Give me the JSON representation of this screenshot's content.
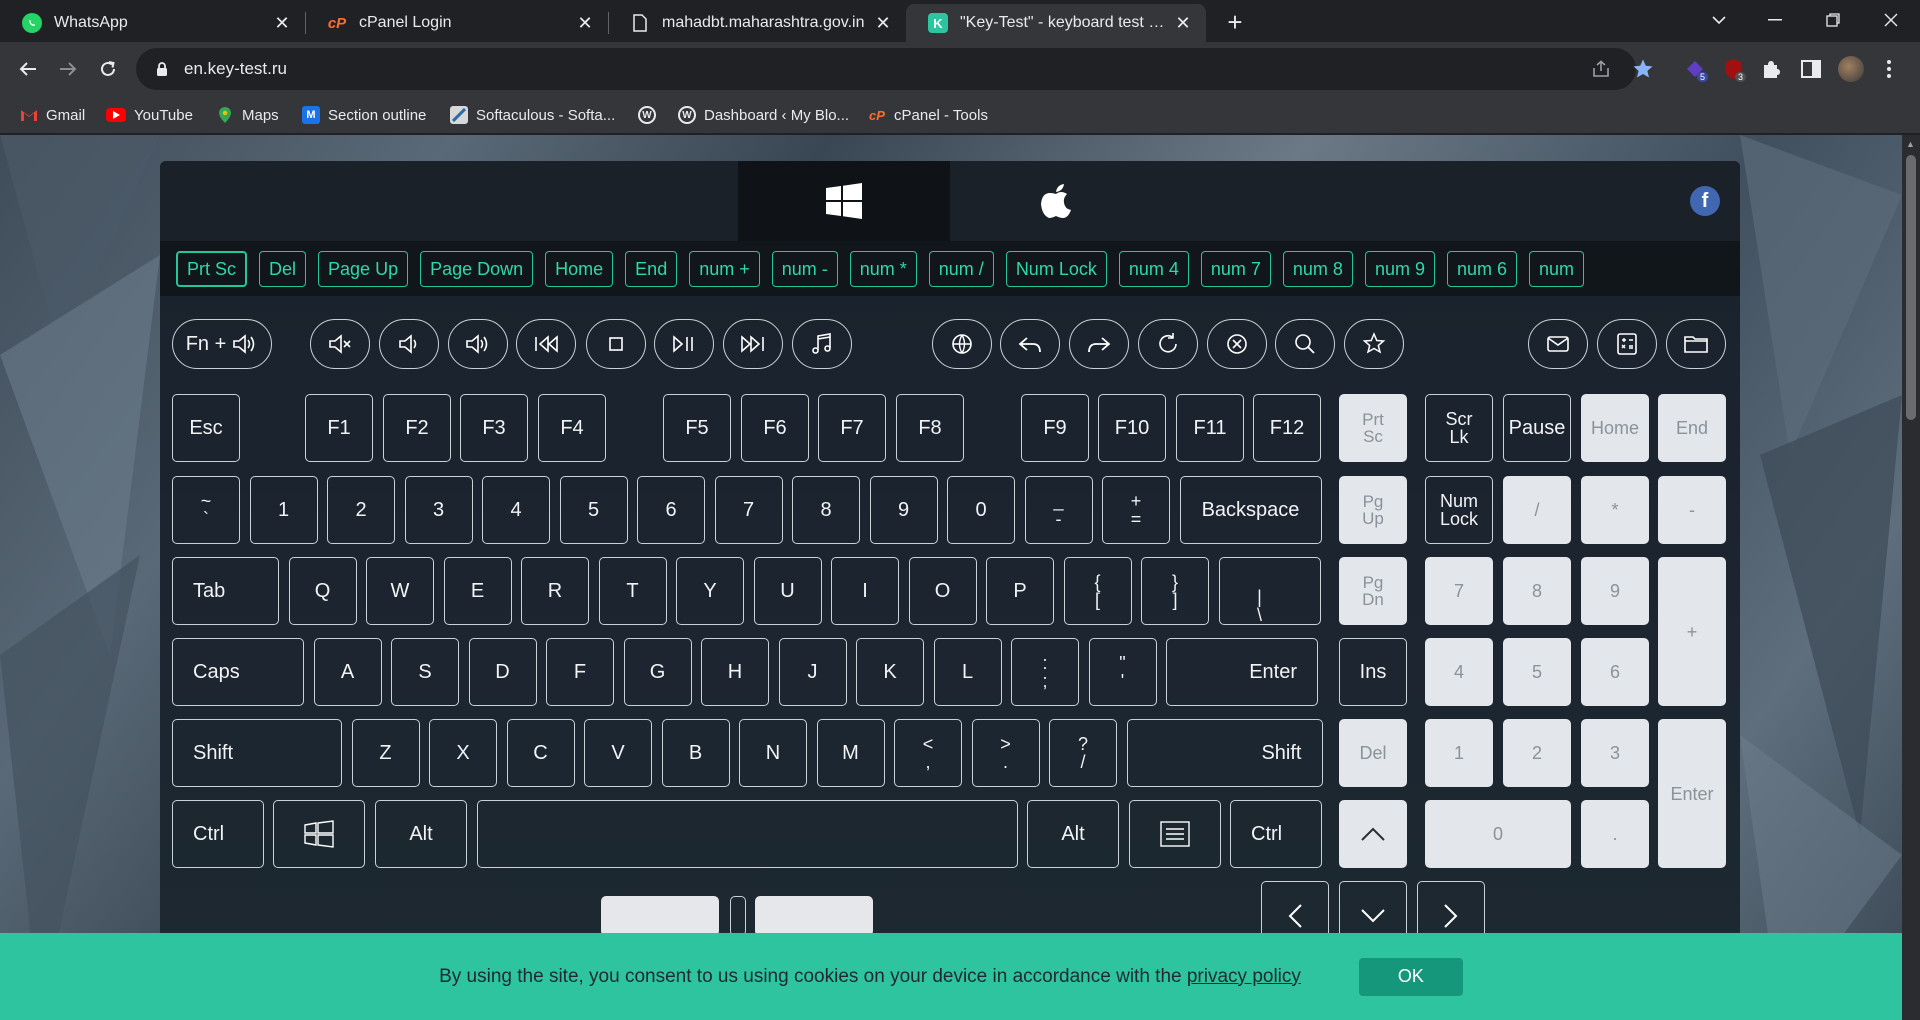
{
  "browser": {
    "tabs": [
      {
        "title": "WhatsApp",
        "icon": "whatsapp-icon",
        "color": "#25d366"
      },
      {
        "title": "cPanel Login",
        "icon": "cpanel-icon",
        "color": "#ff6c2c"
      },
      {
        "title": "mahadbt.maharashtra.gov.in",
        "icon": "page-icon",
        "color": "#ffffff"
      },
      {
        "title": "\"Key-Test\" - keyboard test online",
        "icon": "keytest-icon",
        "color": "#2ec4a0"
      }
    ],
    "new_tab_label": "+",
    "url": "en.key-test.ru",
    "extension_badges": {
      "ext1": "5",
      "ext2": "3"
    },
    "bookmarks": [
      {
        "label": "Gmail",
        "icon": "gmail-icon"
      },
      {
        "label": "YouTube",
        "icon": "youtube-icon"
      },
      {
        "label": "Maps",
        "icon": "maps-icon"
      },
      {
        "label": "Section outline",
        "icon": "moodle-icon"
      },
      {
        "label": "Softaculous - Softa...",
        "icon": "softaculous-icon"
      },
      {
        "label": "",
        "icon": "wordpress-icon"
      },
      {
        "label": "Dashboard ‹ My Blo...",
        "icon": "wordpress-icon"
      },
      {
        "label": "cPanel - Tools",
        "icon": "cpanel-icon"
      }
    ]
  },
  "site": {
    "os_tabs": [
      {
        "name": "windows-logo-icon",
        "active": true
      },
      {
        "name": "apple-logo-icon",
        "active": false
      }
    ],
    "social": "f",
    "history": [
      "Prt Sc",
      "Del",
      "Page Up",
      "Page Down",
      "Home",
      "End",
      "num +",
      "num -",
      "num *",
      "num /",
      "Num Lock",
      "num 4",
      "num 7",
      "num 8",
      "num 9",
      "num 6",
      "num"
    ],
    "fn_key": "Fn +",
    "rows": {
      "row1": [
        "Esc",
        "F1",
        "F2",
        "F3",
        "F4",
        "F5",
        "F6",
        "F7",
        "F8",
        "F9",
        "F10",
        "F11",
        "F12"
      ],
      "row1_extra": [
        [
          "Prt",
          "Sc"
        ],
        [
          "Scr",
          "Lk"
        ],
        [
          "Pause"
        ],
        [
          "Home"
        ],
        [
          "End"
        ]
      ],
      "row2": [
        [
          "~",
          "`"
        ],
        [
          "1"
        ],
        [
          "2"
        ],
        [
          "3"
        ],
        [
          "4"
        ],
        [
          "5"
        ],
        [
          "6"
        ],
        [
          "7"
        ],
        [
          "8"
        ],
        [
          "9"
        ],
        [
          "0"
        ],
        [
          "_",
          "-"
        ],
        [
          "+",
          "="
        ],
        [
          "Backspace"
        ]
      ],
      "row2_extra": [
        [
          "Pg",
          "Up"
        ],
        [
          "Num",
          "Lock"
        ],
        [
          "/"
        ],
        [
          "*"
        ],
        [
          "-"
        ]
      ],
      "row3": [
        [
          "Tab"
        ],
        [
          "Q"
        ],
        [
          "W"
        ],
        [
          "E"
        ],
        [
          "R"
        ],
        [
          "T"
        ],
        [
          "Y"
        ],
        [
          "U"
        ],
        [
          "I"
        ],
        [
          "O"
        ],
        [
          "P"
        ],
        [
          "{",
          "["
        ],
        [
          "}",
          "]"
        ],
        [
          "|",
          "\\"
        ]
      ],
      "row3_extra": [
        [
          "Pg",
          "Dn"
        ],
        [
          "7"
        ],
        [
          "8"
        ],
        [
          "9"
        ],
        [
          "+"
        ]
      ],
      "row4": [
        [
          "Caps"
        ],
        [
          "A"
        ],
        [
          "S"
        ],
        [
          "D"
        ],
        [
          "F"
        ],
        [
          "G"
        ],
        [
          "H"
        ],
        [
          "J"
        ],
        [
          "K"
        ],
        [
          "L"
        ],
        [
          ":",
          ";"
        ],
        [
          "\"",
          "'"
        ],
        [
          "Enter"
        ]
      ],
      "row4_extra": [
        [
          "Ins"
        ],
        [
          "4"
        ],
        [
          "5"
        ],
        [
          "6"
        ]
      ],
      "row5": [
        [
          "Shift"
        ],
        [
          "Z"
        ],
        [
          "X"
        ],
        [
          "C"
        ],
        [
          "V"
        ],
        [
          "B"
        ],
        [
          "N"
        ],
        [
          "M"
        ],
        [
          "<",
          ","
        ],
        [
          ">",
          "."
        ],
        [
          "?",
          "/"
        ],
        [
          "Shift"
        ]
      ],
      "row5_extra": [
        [
          "Del"
        ],
        [
          "1"
        ],
        [
          "2"
        ],
        [
          "3"
        ],
        [
          "Enter"
        ]
      ],
      "row6": [
        [
          "Ctrl"
        ],
        [
          "Alt"
        ],
        [
          "Alt"
        ],
        [
          "Ctrl"
        ]
      ],
      "row6_extra": [
        [
          "0"
        ],
        [
          "."
        ]
      ]
    }
  },
  "cookie": {
    "message": "By using the site, you consent to us using cookies on your device in accordance with the",
    "link": "privacy policy",
    "ok": "OK"
  }
}
